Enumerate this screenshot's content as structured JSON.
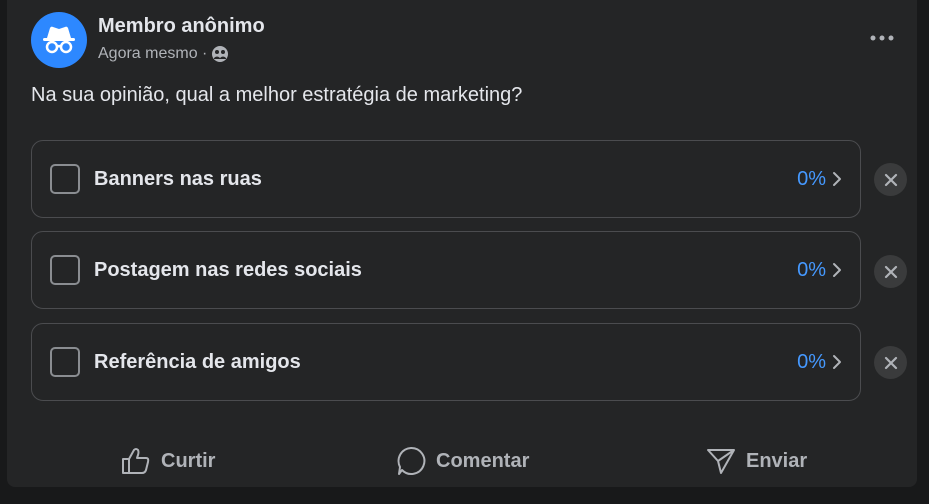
{
  "post": {
    "author": "Membro anônimo",
    "time": "Agora mesmo ·",
    "question": "Na sua opinião, qual a melhor estratégia de marketing?"
  },
  "poll": {
    "options": [
      {
        "label": "Banners nas ruas",
        "percent": "0%"
      },
      {
        "label": "Postagem nas redes sociais",
        "percent": "0%"
      },
      {
        "label": "Referência de amigos",
        "percent": "0%"
      }
    ]
  },
  "actions": {
    "like": "Curtir",
    "comment": "Comentar",
    "send": "Enviar"
  },
  "icons": {
    "avatar": "anonymous-incognito-icon",
    "audience": "group-icon",
    "more": "more-options-icon",
    "remove": "close-icon",
    "chevron": "chevron-right-icon",
    "like": "thumbs-up-icon",
    "comment": "comment-bubble-icon",
    "send": "send-icon"
  },
  "colors": {
    "background": "#18191a",
    "card": "#242526",
    "accent": "#4599ff",
    "avatar": "#2d88ff"
  }
}
